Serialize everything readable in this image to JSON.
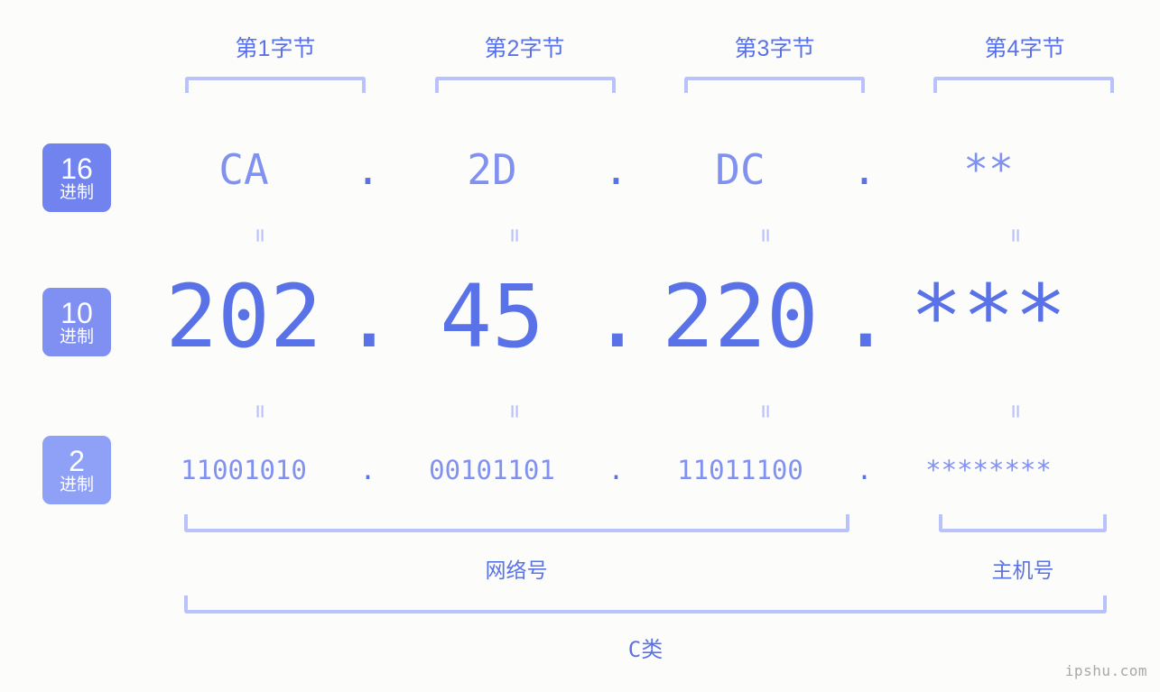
{
  "background_color": "#fcfdfa",
  "accent_color": "#5a72e8",
  "accent_light_color": "#8191f0",
  "bracket_color": "#b9c2fb",
  "byte_headers": [
    {
      "label": "第1字节"
    },
    {
      "label": "第2字节"
    },
    {
      "label": "第3字节"
    },
    {
      "label": "第4字节"
    }
  ],
  "radix_badges": [
    {
      "num": "16",
      "unit": "进制",
      "color": "#7183ee"
    },
    {
      "num": "10",
      "unit": "进制",
      "color": "#7f90f2"
    },
    {
      "num": "2",
      "unit": "进制",
      "color": "#8fa0f7"
    }
  ],
  "rows": {
    "hex": {
      "values": [
        "CA",
        "2D",
        "DC",
        "**"
      ],
      "separator": "."
    },
    "decimal": {
      "values": [
        "202",
        "45",
        "220",
        "***"
      ],
      "separator": "."
    },
    "binary": {
      "values": [
        "11001010",
        "00101101",
        "11011100",
        "********"
      ],
      "separator": "."
    }
  },
  "equality_marks": {
    "symbol": "=",
    "count_per_row": 4
  },
  "sections": {
    "network_label": "网络号",
    "host_label": "主机号",
    "class_label": "C类"
  },
  "watermark": "ipshu.com"
}
